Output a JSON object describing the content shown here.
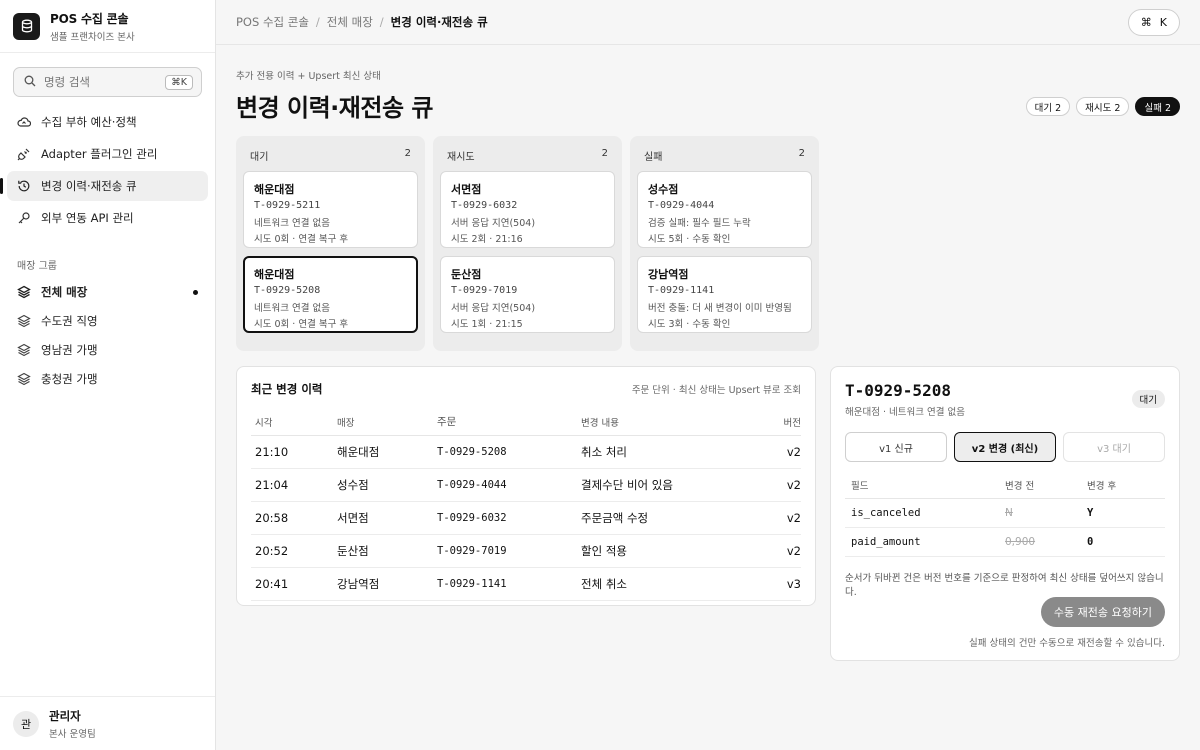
{
  "brand": {
    "title": "POS 수집 콘솔",
    "subtitle": "샘플 프랜차이즈 본사"
  },
  "search": {
    "placeholder": "명령 검색",
    "shortcut": "⌘K"
  },
  "nav": [
    {
      "label": "수집 부하 예산·정책",
      "icon": "cloud-icon"
    },
    {
      "label": "Adapter 플러그인 관리",
      "icon": "plug-icon"
    },
    {
      "label": "변경 이력·재전송 큐",
      "icon": "history-icon",
      "active": true
    },
    {
      "label": "외부 연동 API 관리",
      "icon": "key-icon"
    }
  ],
  "store_group": {
    "label": "매장 그룹",
    "items": [
      {
        "label": "전체 매장",
        "active": true
      },
      {
        "label": "수도권 직영"
      },
      {
        "label": "영남권 가맹"
      },
      {
        "label": "충청권 가맹"
      }
    ]
  },
  "user": {
    "avatar": "관",
    "name": "관리자",
    "team": "본사 운영팀"
  },
  "breadcrumb": [
    "POS 수집 콘솔",
    "전체 매장",
    "변경 이력·재전송 큐"
  ],
  "cmdk": {
    "cmd": "⌘",
    "key": "K"
  },
  "page": {
    "subtitle": "추가 전용 이력 + Upsert 최신 상태",
    "title": "변경 이력·재전송 큐"
  },
  "filters": [
    {
      "label": "대기 2"
    },
    {
      "label": "재시도 2"
    },
    {
      "label": "실패 2",
      "active": true
    }
  ],
  "columns": [
    {
      "title": "대기",
      "count": "2",
      "cards": [
        {
          "store": "해운대점",
          "order": "T-0929-5211",
          "reason": "네트워크 연결 없음",
          "retry": "시도 0회 · 연결 복구 후"
        },
        {
          "store": "해운대점",
          "order": "T-0929-5208",
          "reason": "네트워크 연결 없음",
          "retry": "시도 0회 · 연결 복구 후"
        }
      ]
    },
    {
      "title": "재시도",
      "count": "2",
      "cards": [
        {
          "store": "서면점",
          "order": "T-0929-6032",
          "reason": "서버 응답 지연(504)",
          "retry": "시도 2회 · 21:16"
        },
        {
          "store": "둔산점",
          "order": "T-0929-7019",
          "reason": "서버 응답 지연(504)",
          "retry": "시도 1회 · 21:15"
        }
      ]
    },
    {
      "title": "실패",
      "count": "2",
      "cards": [
        {
          "store": "성수점",
          "order": "T-0929-4044",
          "reason": "검증 실패: 필수 필드 누락",
          "retry": "시도 5회 · 수동 확인"
        },
        {
          "store": "강남역점",
          "order": "T-0929-1141",
          "reason": "버전 충돌: 더 새 변경이 이미 반영됨",
          "retry": "시도 3회 · 수동 확인"
        }
      ]
    }
  ],
  "history": {
    "title": "최근 변경 이력",
    "note": "주문 단위 · 최신 상태는 Upsert 뷰로 조회",
    "headers": [
      "시각",
      "매장",
      "주문",
      "변경 내용",
      "버전"
    ],
    "rows": [
      [
        "21:10",
        "해운대점",
        "T-0929-5208",
        "취소 처리",
        "v2"
      ],
      [
        "21:04",
        "성수점",
        "T-0929-4044",
        "결제수단 비어 있음",
        "v2"
      ],
      [
        "20:58",
        "서면점",
        "T-0929-6032",
        "주문금액 수정",
        "v2"
      ],
      [
        "20:52",
        "둔산점",
        "T-0929-7019",
        "할인 적용",
        "v2"
      ],
      [
        "20:41",
        "강남역점",
        "T-0929-1141",
        "전체 취소",
        "v3"
      ]
    ]
  },
  "detail": {
    "order": "T-0929-5208",
    "subtitle": "해운대점 · 네트워크 연결 없음",
    "badge": "대기",
    "versions": [
      {
        "label": "v1 신규"
      },
      {
        "label": "v2 변경 (최신)",
        "active": true
      },
      {
        "label": "v3 대기",
        "disabled": true
      }
    ],
    "headers": [
      "필드",
      "변경 전",
      "변경 후"
    ],
    "fields": [
      {
        "name": "is_canceled",
        "before": "N",
        "after": "Y"
      },
      {
        "name": "paid_amount",
        "before": "0,900",
        "after": "0"
      }
    ],
    "note": "순서가 뒤바뀐 건은 버전 번호를 기준으로 판정하여 최신 상태를 덮어쓰지 않습니다.",
    "button": "수동 재전송 요청하기",
    "footer": "실패 상태의 건만 수동으로 재전송할 수 있습니다."
  }
}
